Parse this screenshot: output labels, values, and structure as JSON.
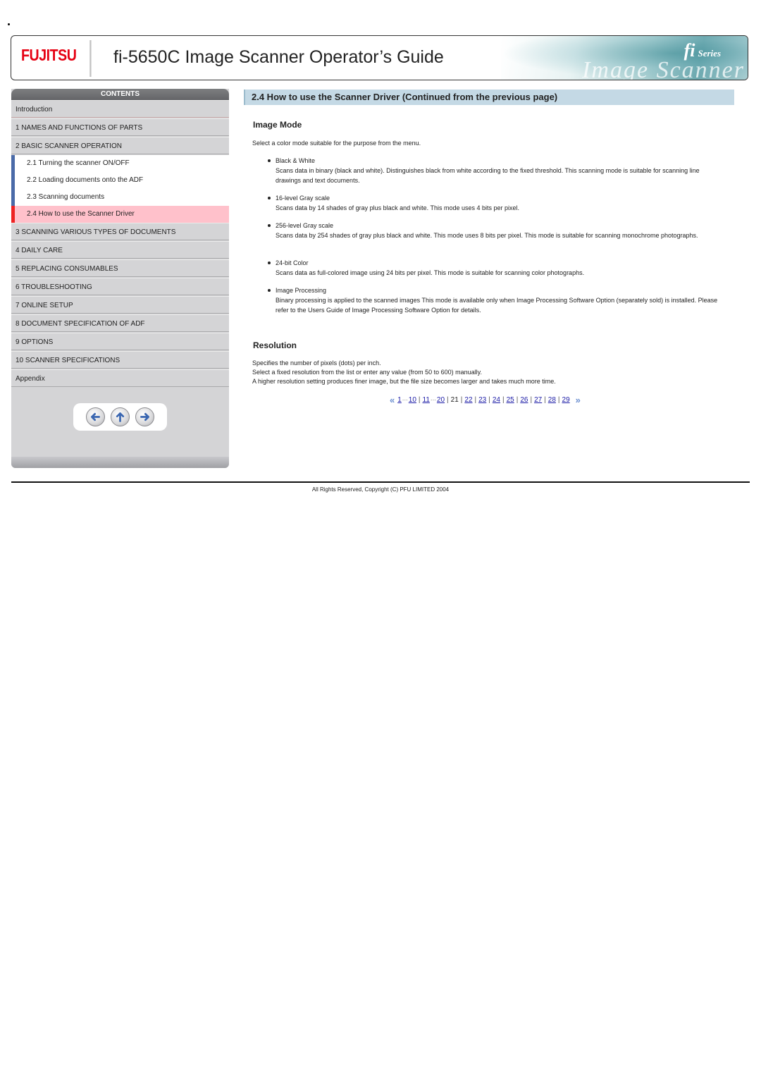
{
  "banner": {
    "logo": "FUJITSU",
    "title": "fi-5650C Image Scanner Operator’s Guide",
    "badge_fi": "fi",
    "badge_series": "Series",
    "art_text": "Image Scanner"
  },
  "sidebar": {
    "header": "CONTENTS",
    "items_top": [
      {
        "label": "Introduction"
      },
      {
        "label": "1 NAMES AND FUNCTIONS OF PARTS"
      },
      {
        "label": "2 BASIC SCANNER OPERATION"
      }
    ],
    "sub_items": [
      {
        "label": "2.1 Turning the scanner ON/OFF",
        "active": false
      },
      {
        "label": "2.2 Loading documents onto the ADF",
        "active": false
      },
      {
        "label": "2.3 Scanning documents",
        "active": false
      },
      {
        "label": "2.4 How to use the Scanner Driver",
        "active": true
      }
    ],
    "items_bottom": [
      {
        "label": "3 SCANNING VARIOUS TYPES OF DOCUMENTS"
      },
      {
        "label": "4 DAILY CARE"
      },
      {
        "label": "5 REPLACING CONSUMABLES"
      },
      {
        "label": "6 TROUBLESHOOTING"
      },
      {
        "label": "7 ONLINE SETUP"
      },
      {
        "label": "8 DOCUMENT SPECIFICATION OF ADF"
      },
      {
        "label": "9 OPTIONS"
      },
      {
        "label": "10 SCANNER SPECIFICATIONS"
      },
      {
        "label": "Appendix"
      }
    ],
    "nav_buttons": [
      {
        "icon": "arrow-left-icon",
        "label": "Previous"
      },
      {
        "icon": "arrow-up-icon",
        "label": "Top"
      },
      {
        "icon": "arrow-right-icon",
        "label": "Next"
      }
    ]
  },
  "main": {
    "section_title": "2.4 How to use the Scanner Driver (Continued from the previous page)",
    "image_mode": {
      "heading": "Image Mode",
      "intro": "Select a color mode suitable for the purpose from the menu.",
      "modes": [
        {
          "name": "Black & White",
          "desc": "Scans data in binary (black and white). Distinguishes black from white according to the fixed threshold. This scanning mode is suitable for scanning line drawings and text documents."
        },
        {
          "name": "16-level Gray scale",
          "desc": "Scans data by 14 shades of gray plus black and white. This mode uses 4 bits per pixel."
        },
        {
          "name": "256-level Gray scale",
          "desc": "Scans data by 254 shades of gray plus black and white. This mode uses 8 bits per pixel. This mode is suitable for scanning monochrome photographs."
        },
        {
          "name": "24-bit Color",
          "desc": "Scans data as full-colored image using 24 bits per pixel. This mode is suitable for scanning color photographs."
        },
        {
          "name": "Image Processing",
          "desc": "Binary processing is applied to the scanned images This mode is available only when Image Processing Software Option (separately sold) is installed. Please refer to the Users Guide of Image Processing Software Option for details."
        }
      ]
    },
    "resolution": {
      "heading": "Resolution",
      "lines": [
        "Specifies the number of pixels (dots) per inch.",
        "Select a fixed resolution from the list or enter any value (from 50 to 600) manually.",
        "A higher resolution setting produces finer image, but the file size becomes larger and takes much more time."
      ]
    },
    "pager": {
      "prev": "«",
      "next": "»",
      "range1_start": "1",
      "range1_end": "10",
      "range2_start": "11",
      "range2_end": "20",
      "current": "21",
      "pages": [
        "22",
        "23",
        "24",
        "25",
        "26",
        "27",
        "28",
        "29"
      ],
      "ellipsis": "···",
      "separator": "|"
    }
  },
  "footer": {
    "copyright": "All Rights Reserved, Copyright (C) PFU LIMITED 2004"
  },
  "colors": {
    "logo_red": "#e60012",
    "section_bar": "#c4d9e5",
    "active_nav_bg": "#ffc1cb",
    "active_nav_marker": "#ee2222",
    "sub_nav_marker": "#4a6aa8",
    "link": "#1a1aa6"
  }
}
